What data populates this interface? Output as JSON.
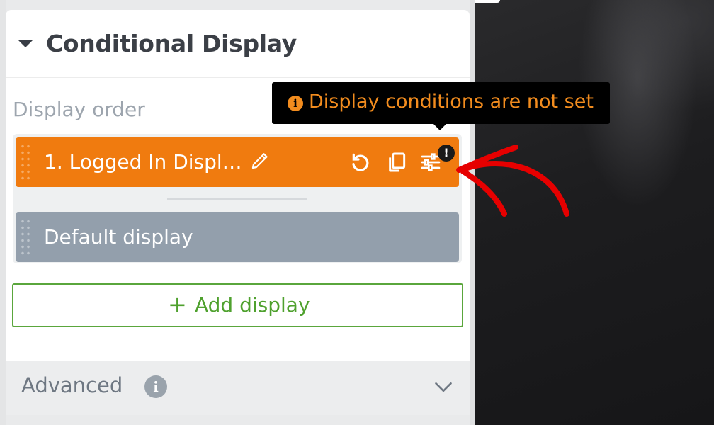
{
  "panel": {
    "section_title": "Conditional Display",
    "display_order_label": "Display order",
    "items": [
      {
        "label": "1. Logged In Displ…",
        "state": "active"
      },
      {
        "label": "Default display",
        "state": "default"
      }
    ],
    "add_button_label": "Add display",
    "advanced_label": "Advanced"
  },
  "tooltip": {
    "text": "Display conditions are not set"
  },
  "icons": {
    "caret": "caret-down-icon",
    "pencil": "pencil-icon",
    "reset": "reset-icon",
    "duplicate": "duplicate-icon",
    "settings": "sliders-icon",
    "warning": "exclamation-badge-icon",
    "info": "info-icon",
    "chevron": "chevron-down-icon"
  },
  "colors": {
    "accent_orange": "#f07b0f",
    "default_item": "#939fac",
    "add_green": "#4fa12e",
    "annotation_red": "#e60000"
  }
}
